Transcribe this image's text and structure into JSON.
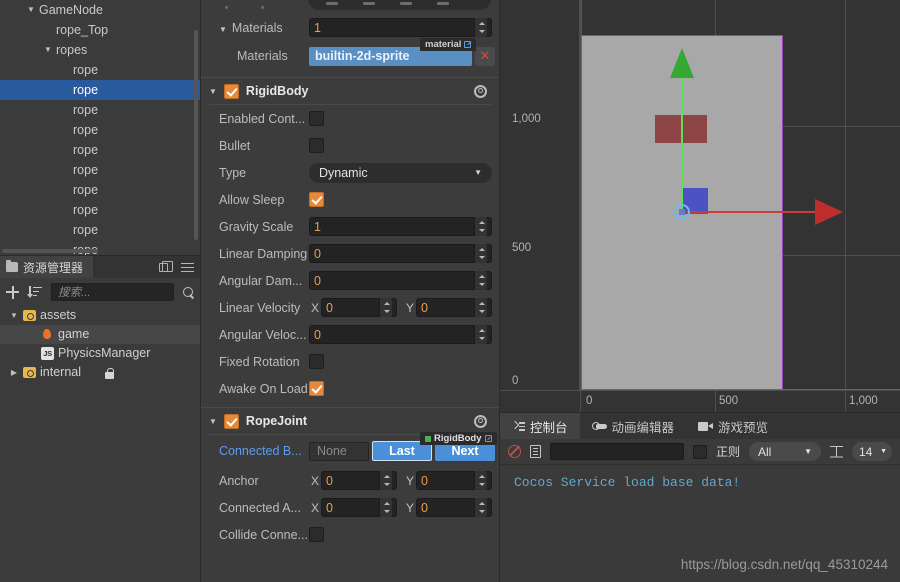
{
  "hierarchy": {
    "nodes": [
      {
        "label": "GameNode",
        "depth": 1,
        "twisty": "▼",
        "selected": false
      },
      {
        "label": "rope_Top",
        "depth": 2,
        "twisty": "",
        "selected": false
      },
      {
        "label": "ropes",
        "depth": 2,
        "twisty": "▼",
        "selected": false
      },
      {
        "label": "rope",
        "depth": 3,
        "twisty": "",
        "selected": false
      },
      {
        "label": "rope",
        "depth": 3,
        "twisty": "",
        "selected": true
      },
      {
        "label": "rope",
        "depth": 3,
        "twisty": "",
        "selected": false
      },
      {
        "label": "rope",
        "depth": 3,
        "twisty": "",
        "selected": false
      },
      {
        "label": "rope",
        "depth": 3,
        "twisty": "",
        "selected": false
      },
      {
        "label": "rope",
        "depth": 3,
        "twisty": "",
        "selected": false
      },
      {
        "label": "rope",
        "depth": 3,
        "twisty": "",
        "selected": false
      },
      {
        "label": "rope",
        "depth": 3,
        "twisty": "",
        "selected": false
      },
      {
        "label": "rope",
        "depth": 3,
        "twisty": "",
        "selected": false
      },
      {
        "label": "rope",
        "depth": 3,
        "twisty": "",
        "selected": false
      }
    ]
  },
  "assets": {
    "tab_label": "资源管理器",
    "search_placeholder": "搜索...",
    "tree": [
      {
        "label": "assets",
        "icon": "folder-icon",
        "depth": 1,
        "twisty": "▼",
        "selected": false,
        "locked": false
      },
      {
        "label": "game",
        "icon": "flame-icon",
        "depth": 2,
        "twisty": "",
        "selected": true,
        "locked": false
      },
      {
        "label": "PhysicsManager",
        "icon": "js-file-icon",
        "depth": 2,
        "twisty": "",
        "selected": false,
        "locked": false
      },
      {
        "label": "internal",
        "icon": "folder-icon",
        "depth": 1,
        "twisty": "▶",
        "selected": false,
        "locked": true
      }
    ]
  },
  "inspector": {
    "materials": {
      "section_label": "Materials",
      "count": "1",
      "item_label": "Materials",
      "badge": "material",
      "value": "builtin-2d-sprite",
      "remove_label": "✕"
    },
    "rigidbody": {
      "title": "RigidBody",
      "enabled": true,
      "rows": [
        {
          "label": "Enabled Cont...",
          "type": "checkbox",
          "value": false
        },
        {
          "label": "Bullet",
          "type": "checkbox",
          "value": false
        },
        {
          "label": "Type",
          "type": "dropdown",
          "value": "Dynamic"
        },
        {
          "label": "Allow Sleep",
          "type": "checkbox",
          "value": true
        },
        {
          "label": "Gravity Scale",
          "type": "number",
          "value": "1"
        },
        {
          "label": "Linear Damping",
          "type": "number",
          "value": "0"
        },
        {
          "label": "Angular Dam...",
          "type": "number",
          "value": "0"
        },
        {
          "label": "Linear Velocity",
          "type": "vec2",
          "x": "0",
          "y": "0"
        },
        {
          "label": "Angular Veloc...",
          "type": "number",
          "value": "0"
        },
        {
          "label": "Fixed Rotation",
          "type": "checkbox",
          "value": false
        },
        {
          "label": "Awake On Load",
          "type": "checkbox",
          "value": true
        }
      ]
    },
    "ropejoint": {
      "title": "RopeJoint",
      "enabled": true,
      "connected_body_label": "Connected B...",
      "connected_body_badge": "RigidBody",
      "connected_body_value": "None",
      "last_button": "Last",
      "next_button": "Next",
      "rows": [
        {
          "label": "Anchor",
          "type": "vec2",
          "x": "0",
          "y": "0"
        },
        {
          "label": "Connected A...",
          "type": "vec2",
          "x": "0",
          "y": "0"
        },
        {
          "label": "Collide Conne...",
          "type": "checkbox",
          "value": false
        }
      ]
    }
  },
  "scene": {
    "vruler_ticks": [
      "1,000",
      "500",
      "0"
    ],
    "hruler_ticks": [
      "0",
      "500",
      "1,000"
    ],
    "colors": {
      "canvas_fill": "#a8a8a8",
      "canvas_border": "#9a3fc4",
      "gizmo_y": "#5ae05a",
      "gizmo_x": "#cf3b3b",
      "node_red": "#8c4444",
      "node_blue": "#4b52c2"
    }
  },
  "console": {
    "tabs": [
      {
        "label": "控制台",
        "icon": "console-icon",
        "active": true
      },
      {
        "label": "动画编辑器",
        "icon": "animation-icon",
        "active": false
      },
      {
        "label": "游戏预览",
        "icon": "camera-icon",
        "active": false
      }
    ],
    "toolbar": {
      "clear_icon": "ban-icon",
      "file_icon": "document-icon",
      "filter_value": "",
      "regex_label": "正则",
      "regex_checked": false,
      "level_value": "All",
      "font_size_icon": "text-size-icon",
      "font_size_value": "14"
    },
    "log_message": "Cocos Service load base data!"
  },
  "watermark": "https://blog.csdn.net/qq_45310244"
}
